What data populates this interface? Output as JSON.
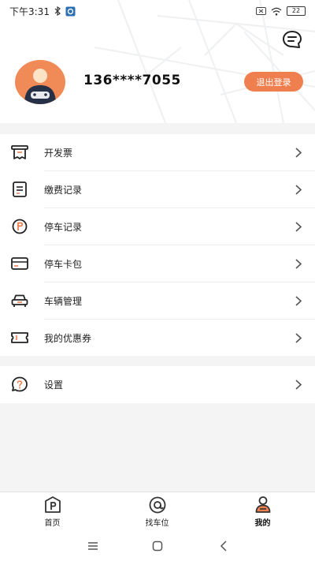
{
  "status_bar": {
    "time": "下午3:31",
    "battery": "22"
  },
  "profile": {
    "phone": "136****7055",
    "logout_label": "退出登录"
  },
  "menu": {
    "group1": [
      {
        "label": "开发票",
        "icon": "invoice-icon"
      },
      {
        "label": "缴费记录",
        "icon": "payment-record-icon"
      },
      {
        "label": "停车记录",
        "icon": "parking-record-icon"
      },
      {
        "label": "停车卡包",
        "icon": "card-wallet-icon"
      },
      {
        "label": "车辆管理",
        "icon": "car-icon"
      },
      {
        "label": "我的优惠券",
        "icon": "coupon-icon"
      }
    ],
    "group2": [
      {
        "label": "设置",
        "icon": "help-settings-icon"
      }
    ]
  },
  "tabbar": {
    "tabs": [
      {
        "label": "首页",
        "icon": "parking-home-icon"
      },
      {
        "label": "找车位",
        "icon": "find-spot-icon"
      },
      {
        "label": "我的",
        "icon": "profile-icon",
        "active": true
      }
    ]
  },
  "colors": {
    "accent": "#ef7f4f",
    "avatar_bg": "#f08a57",
    "avatar_body": "#263047"
  }
}
